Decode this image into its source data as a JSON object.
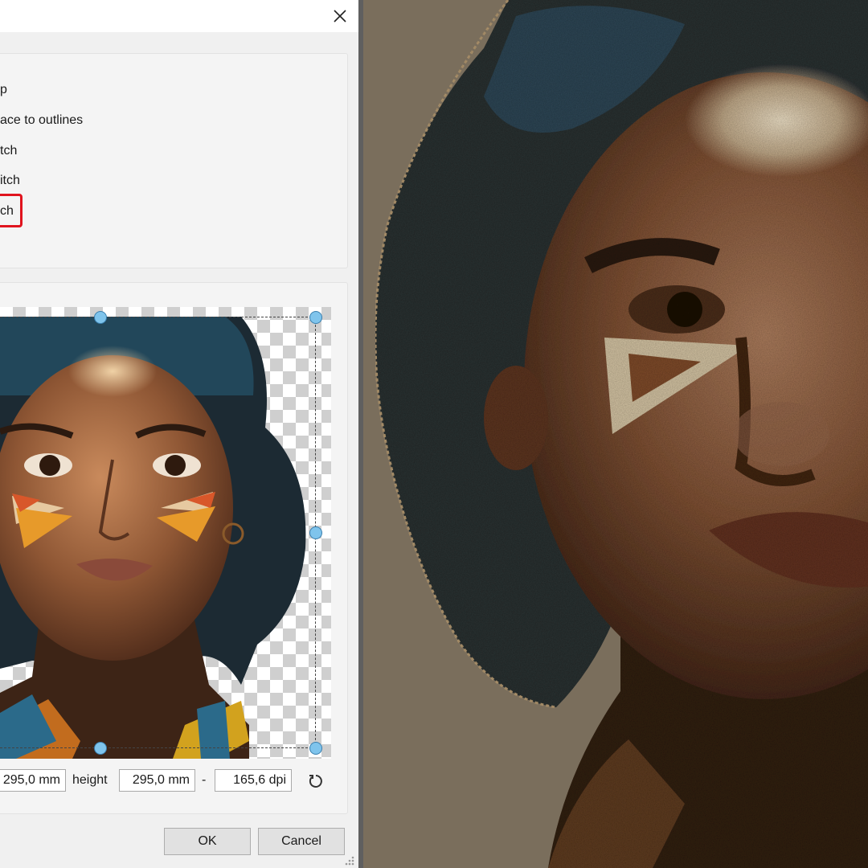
{
  "dialog": {
    "options": [
      {
        "label": "p"
      },
      {
        "label": "ace to outlines"
      },
      {
        "label": "tch"
      },
      {
        "label": "itch"
      },
      {
        "label": "ch",
        "highlighted": true
      }
    ],
    "size": {
      "width_value": "295,0 mm",
      "height_label": "height",
      "height_value": "295,0 mm",
      "separator": "-",
      "dpi_value": "165,6 dpi"
    },
    "buttons": {
      "ok": "OK",
      "cancel": "Cancel"
    }
  },
  "colors": {
    "highlight": "#e0141e",
    "handle": "#7fc4ec",
    "embroidery_background": "#7a6e5c"
  }
}
